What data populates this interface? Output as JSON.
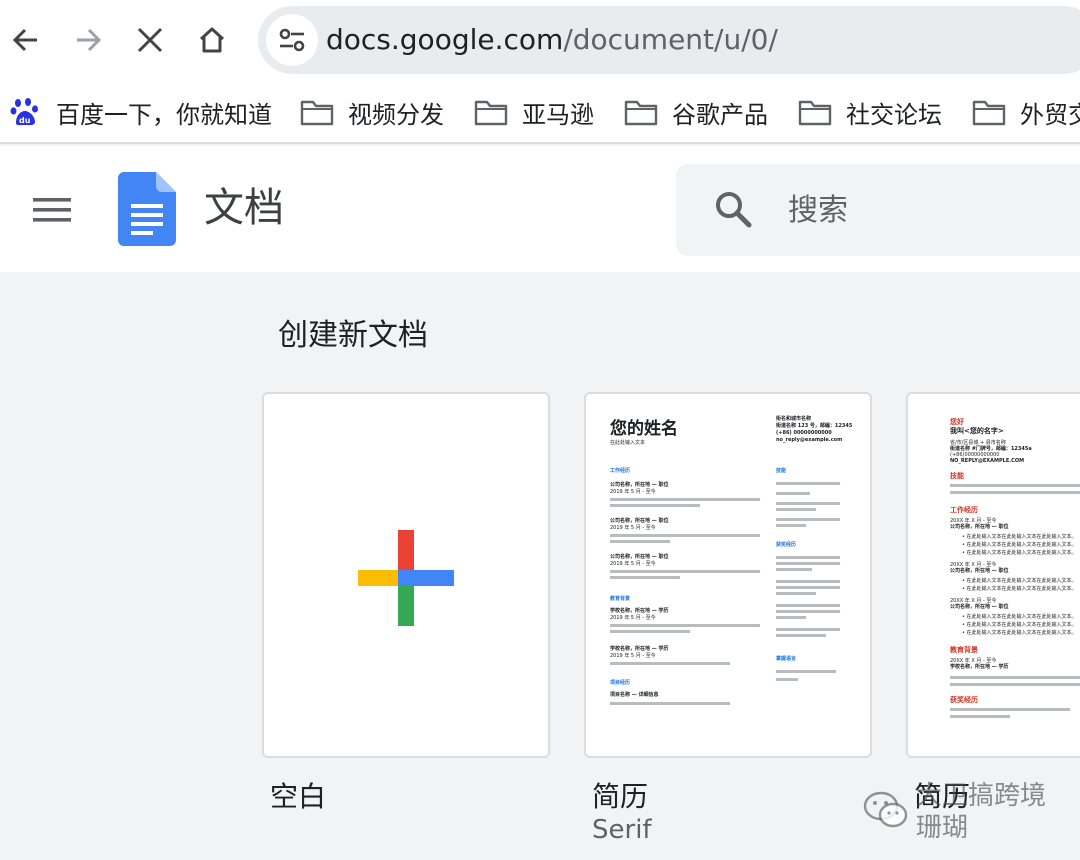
{
  "browser": {
    "nav": {
      "back": "back-arrow-icon",
      "forward": "forward-arrow-icon",
      "stop": "close-icon",
      "home": "home-icon"
    },
    "address_bar": {
      "host": "docs.google.com",
      "path": "/document/u/0/"
    },
    "bookmarks": [
      {
        "label": "百度一下，你就知道",
        "icon": "baidu-icon"
      },
      {
        "label": "视频分发",
        "icon": "folder-icon"
      },
      {
        "label": "亚马逊",
        "icon": "folder-icon"
      },
      {
        "label": "谷歌产品",
        "icon": "folder-icon"
      },
      {
        "label": "社交论坛",
        "icon": "folder-icon"
      },
      {
        "label": "外贸交",
        "icon": "folder-icon"
      }
    ]
  },
  "header": {
    "app_title": "文档",
    "search_placeholder": "搜索"
  },
  "gallery": {
    "title": "创建新文档",
    "templates": [
      {
        "label": "空白",
        "sub": ""
      },
      {
        "label": "简历",
        "sub": "Serif"
      },
      {
        "label": "简历",
        "sub": ""
      }
    ],
    "resume_serif": {
      "name": "您的姓名",
      "subtitle": "在此处输入文本",
      "contact": [
        "街名和城市名称",
        "街道名称 123 号，邮编：12345",
        "(+86) 00000000000",
        "no_reply@example.com"
      ],
      "sections": [
        "工作经历",
        "教育背景",
        "项目经历",
        "技能",
        "获奖经历",
        "掌握语言"
      ],
      "job_line": "公司名称，所在地 — 职位",
      "school_line": "学校名称，所在地 — 学历",
      "project_line": "项目名称 — 详细信息",
      "date_line": "2019 年 5 月 - 至今",
      "filler": "在此处输入文本在此处输入文本在此处输入文本在此处输入文本在此处输入文本"
    },
    "resume_modern": {
      "greeting": "您好",
      "name": "我叫<您的名字>",
      "contact": [
        "省/市/区县城 + 县市名称",
        "街道名称 #门牌号，邮编：12345a",
        "(+86)00000000000",
        "NO_REPLY@EXAMPLE.COM"
      ],
      "sections": [
        "技能",
        "工作经历",
        "教育背景",
        "获奖经历"
      ],
      "job_line": "公司名称，所在地 — 职位",
      "school_line": "学校名称，所在地 — 学历",
      "date_line": "20XX 年 X 月 - 至今",
      "bullet": "• 在此处输入文本在此处输入文本在此处输入文本。",
      "filler": "在此处输入文本在此处输入文本在此处输入文本在此处输入文本"
    }
  },
  "watermark": {
    "text1": "大卫搞跨境",
    "text2": "珊瑚"
  },
  "colors": {
    "docs_blue": "#4285f4",
    "plus_red": "#ea4335",
    "plus_blue": "#4285f4",
    "plus_green": "#34a853",
    "plus_yellow": "#fbbc04"
  }
}
